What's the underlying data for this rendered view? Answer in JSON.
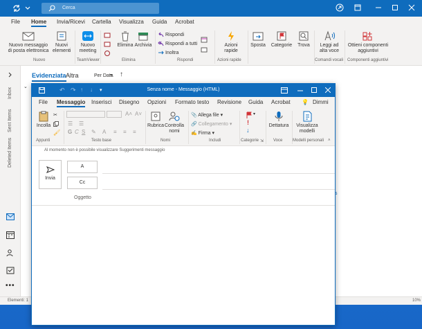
{
  "main": {
    "search_placeholder": "Cerca",
    "tabs": [
      "File",
      "Home",
      "Invia/Ricevi",
      "Cartella",
      "Visualizza",
      "Guida",
      "Acrobat"
    ],
    "ribbon": {
      "new_email": "Nuovo messaggio\ndi posta elettronica",
      "new_items": "Nuovi\nelementi",
      "group_new": "Nuovo",
      "new_meeting": "Nuovo\nmeeting",
      "group_teamviewer": "TeamViewer",
      "delete": "Elimina",
      "archive": "Archivia",
      "group_delete": "Elimina",
      "reply": "Rispondi",
      "reply_all": "Rispondi a tutti",
      "forward": "Inoltra",
      "group_respond": "Rispondi",
      "quick_actions": "Azioni\nrapide",
      "group_quick": "Azioni rapide",
      "move": "Sposta",
      "categories": "Categorie",
      "find": "Trova",
      "read_aloud": "Leggi ad\nalta voce",
      "group_voice": "Comandi vocali",
      "get_addins": "Ottieni componenti\naggiuntivi",
      "group_addins": "Componenti aggiuntivi"
    },
    "folders": [
      "Inbox",
      "Sent Items",
      "Deleted Items"
    ],
    "filter": {
      "focused": "Evidenziata",
      "other": "Altra",
      "sort": "Per Data"
    },
    "status": {
      "items": "Elementi: 1",
      "zoom": "10%"
    }
  },
  "compose": {
    "title": "Senza nome  -  Messaggio (HTML)",
    "tabs": [
      "File",
      "Messaggio",
      "Inserisci",
      "Disegno",
      "Opzioni",
      "Formato testo",
      "Revisione",
      "Guida",
      "Acrobat",
      "Dimmi"
    ],
    "ribbon": {
      "paste": "Incolla",
      "group_clipboard": "Appunti",
      "group_basic_text": "Testo base",
      "address_book": "Rubrica",
      "check_names": "Controlla\nnomi",
      "group_names": "Nomi",
      "attach_file": "Allega file",
      "link": "Collegamento",
      "signature": "Firma",
      "group_include": "Includi",
      "group_tags": "Categorie",
      "dictate": "Dettatura",
      "group_voice": "Voce",
      "view_templates": "Visualizza\nmodelli",
      "group_templates": "Modelli personali"
    },
    "info_bar": "Al momento non è possibile visualizzare Suggerimenti messaggio",
    "send": "Invia",
    "to": "A",
    "cc": "Cc",
    "subject": "Oggetto"
  },
  "colors": {
    "accent": "#0f6cbd",
    "ribbon_bg": "#f3f2f1"
  }
}
